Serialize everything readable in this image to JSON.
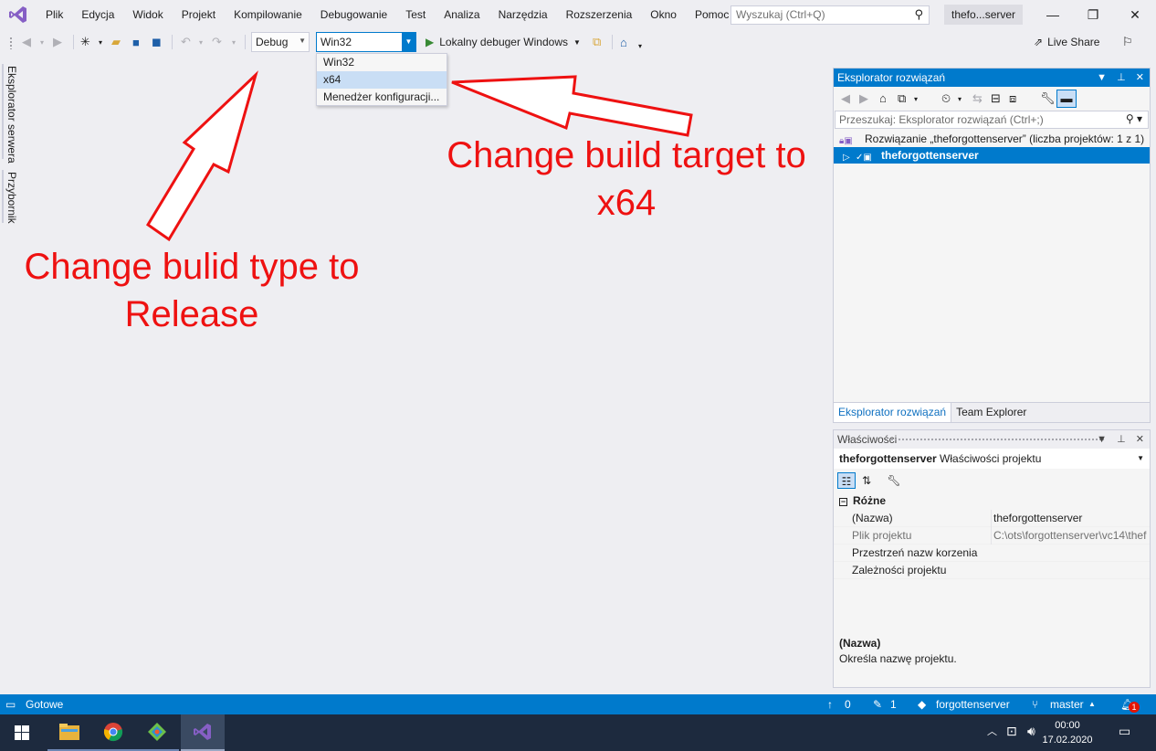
{
  "menu": {
    "items": [
      "Plik",
      "Edycja",
      "Widok",
      "Projekt",
      "Kompilowanie",
      "Debugowanie",
      "Test",
      "Analiza",
      "Narzędzia",
      "Rozszerzenia",
      "Okno",
      "Pomoc"
    ],
    "search_placeholder": "Wyszukaj (Ctrl+Q)",
    "solution_name": "thefo...server"
  },
  "toolbar": {
    "configuration": "Debug",
    "platform": "Win32",
    "run_label": "Lokalny debuger Windows",
    "live_share": "Live Share"
  },
  "platform_dropdown": {
    "options": [
      "Win32",
      "x64",
      "Menedżer konfiguracji..."
    ],
    "highlighted": "x64"
  },
  "side_tabs": [
    "Eksplorator serwera",
    "Przybornik"
  ],
  "solution_explorer": {
    "title": "Eksplorator rozwiązań",
    "search_placeholder": "Przeszukaj: Eksplorator rozwiązań (Ctrl+;)",
    "solution_node": "Rozwiązanie „theforgottenserver” (liczba projektów: 1 z 1)",
    "project_node": "theforgottenserver",
    "tabs": [
      "Eksplorator rozwiązań",
      "Team Explorer"
    ]
  },
  "properties": {
    "title": "Właściwości",
    "object_name": "theforgottenserver",
    "object_type": "Właściwości projektu",
    "category": "Różne",
    "rows": [
      {
        "key": "(Nazwa)",
        "value": "theforgottenserver",
        "readonly": false
      },
      {
        "key": "Plik projektu",
        "value": "C:\\ots\\forgottenserver\\vc14\\thef",
        "readonly": true
      },
      {
        "key": "Przestrzeń nazw korzenia",
        "value": "",
        "readonly": false
      },
      {
        "key": "Zależności projektu",
        "value": "",
        "readonly": false
      }
    ],
    "description_title": "(Nazwa)",
    "description_text": "Określa nazwę projektu."
  },
  "statusbar": {
    "status": "Gotowe",
    "up_count": "0",
    "edit_count": "1",
    "repo": "forgottenserver",
    "branch": "master",
    "notifications": "1"
  },
  "taskbar": {
    "time": "00:00",
    "date": "17.02.2020"
  },
  "annotations": {
    "build_type": "Change bulid type to Release",
    "build_type_line1": "Change bulid type to",
    "build_type_line2": "Release",
    "build_target_line1": "Change build target to",
    "build_target_line2": "x64",
    "color": "#ee1111"
  },
  "colors": {
    "accent": "#007acc",
    "vs_purple": "#865fc5",
    "background": "#eeeef2"
  }
}
